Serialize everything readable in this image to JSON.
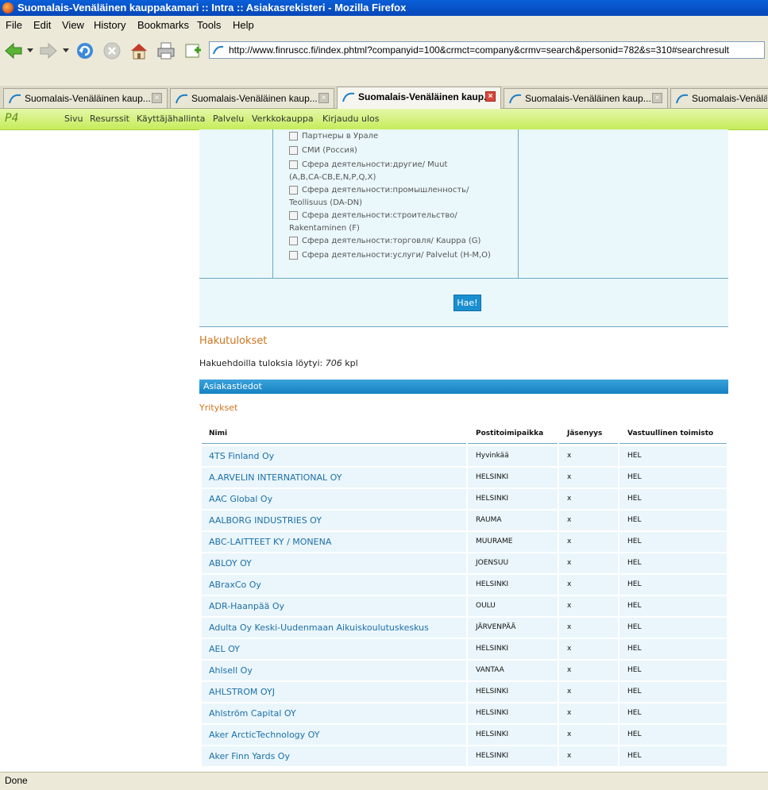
{
  "window": {
    "title": "Suomalais-Venäläinen kauppakamari :: Intra :: Asiakasrekisteri - Mozilla Firefox"
  },
  "menu": {
    "file": "File",
    "edit": "Edit",
    "view": "View",
    "history": "History",
    "bookmarks": "Bookmarks",
    "tools": "Tools",
    "help": "Help"
  },
  "url": "http://www.finruscc.fi/index.phtml?companyid=100&crmct=company&crmv=search&personid=782&s=310#searchresult",
  "tabs": [
    {
      "label": "Suomalais-Venäläinen kaup..."
    },
    {
      "label": "Suomalais-Venäläinen kaup..."
    },
    {
      "label": "Suomalais-Venäläinen kaup..."
    },
    {
      "label": "Suomalais-Venäläinen kaup..."
    },
    {
      "label": "Suomalais-Venäläinen kaup..."
    }
  ],
  "appnav": {
    "logo": "P4",
    "items": [
      "Sivu",
      "Resurssit",
      "Käyttäjähallinta",
      "Palvelu",
      "Verkkokauppa",
      "Kirjaudu ulos"
    ]
  },
  "filters": [
    {
      "l1": "Партнеры в Урале",
      "l2": ""
    },
    {
      "l1": "СМИ (Россия)",
      "l2": ""
    },
    {
      "l1": "Сфера деятельности:другие/ Muut",
      "l2": "(A,B,CA-CB,E,N,P,Q,X)"
    },
    {
      "l1": "Сфера деятельности:промышленность/",
      "l2": "Teollisuus (DA-DN)"
    },
    {
      "l1": "Сфера деятельности:строительство/",
      "l2": "Rakentaminen (F)"
    },
    {
      "l1": "Сфера деятельности:торговля/ Kauppa (G)",
      "l2": ""
    },
    {
      "l1": "Сфера деятельности:услуги/ Palvelut (H-M,O)",
      "l2": ""
    }
  ],
  "search_button": "Hae!",
  "results": {
    "title": "Hakutulokset",
    "count_prefix": "Hakuehdoilla tuloksia löytyi: ",
    "count": "706",
    "count_suffix": " kpl",
    "section": "Asiakastiedot",
    "subsection": "Yritykset"
  },
  "table": {
    "headers": [
      "Nimi",
      "Postitoimipaikka",
      "Jäsenyys",
      "Vastuullinen toimisto"
    ],
    "rows": [
      [
        "4TS Finland Oy",
        "Hyvinkää",
        "x",
        "HEL"
      ],
      [
        "A.ARVELIN INTERNATIONAL OY",
        "HELSINKI",
        "x",
        "HEL"
      ],
      [
        "AAC Global Oy",
        "HELSINKI",
        "x",
        "HEL"
      ],
      [
        "AALBORG INDUSTRIES OY",
        "RAUMA",
        "x",
        "HEL"
      ],
      [
        "ABC-LAITTEET KY / MONENA",
        "MUURAME",
        "x",
        "HEL"
      ],
      [
        "ABLOY OY",
        "JOENSUU",
        "x",
        "HEL"
      ],
      [
        "ABraxCo Oy",
        "HELSINKI",
        "x",
        "HEL"
      ],
      [
        "ADR-Haanpää Oy",
        "OULU",
        "x",
        "HEL"
      ],
      [
        "Adulta Oy Keski-Uudenmaan Aikuiskoulutuskeskus",
        "JÄRVENPÄÄ",
        "x",
        "HEL"
      ],
      [
        "AEL OY",
        "HELSINKI",
        "x",
        "HEL"
      ],
      [
        "Ahlsell Oy",
        "VANTAA",
        "x",
        "HEL"
      ],
      [
        "AHLSTROM OYJ",
        "HELSINKI",
        "x",
        "HEL"
      ],
      [
        "Ahlström Capital OY",
        "HELSINKI",
        "x",
        "HEL"
      ],
      [
        "Aker ArcticTechnology OY",
        "HELSINKI",
        "x",
        "HEL"
      ],
      [
        "Aker Finn Yards Oy",
        "HELSINKI",
        "x",
        "HEL"
      ]
    ]
  },
  "status": "Done"
}
